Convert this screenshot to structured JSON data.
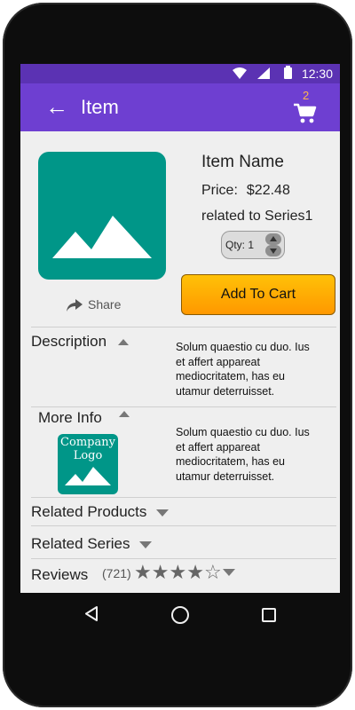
{
  "status_bar": {
    "time": "12:30",
    "icons": [
      "wifi-icon",
      "signal-icon",
      "battery-icon"
    ]
  },
  "app_bar": {
    "title": "Item",
    "back_icon": "arrow-left-icon",
    "cart_icon": "shopping-cart-icon",
    "cart_count": "2",
    "colors": {
      "status": "#5b32b3",
      "bar": "#6e3fd1",
      "badge": "#ffb74d"
    }
  },
  "item": {
    "image_icon": "image-placeholder-icon",
    "share_label": "Share",
    "name": "Item Name",
    "price_label": "Price:",
    "price_value": "$22.48",
    "related_text": "related to Series1",
    "qty_label": "Qty: 1",
    "add_to_cart_label": "Add To Cart",
    "thumb_color": "#009688"
  },
  "sections": {
    "description": {
      "title": "Description",
      "text": "Solum quaestio cu duo. Ius et affert appareat mediocritatem, has eu utamur deterruisset."
    },
    "more_info": {
      "title": "More Info",
      "logo_line1": "Company",
      "logo_line2": "Logo",
      "text": "Solum quaestio cu duo. Ius et affert appareat mediocritatem, has eu utamur deterruisset."
    },
    "related_products": {
      "title": "Related Products"
    },
    "related_series": {
      "title": "Related Series"
    },
    "reviews": {
      "title": "Reviews",
      "count": "(721)",
      "rating": 4,
      "max_rating": 5
    }
  },
  "nav_bar": {
    "icons": [
      "back-triangle-icon",
      "home-circle-icon",
      "recents-square-icon"
    ]
  }
}
